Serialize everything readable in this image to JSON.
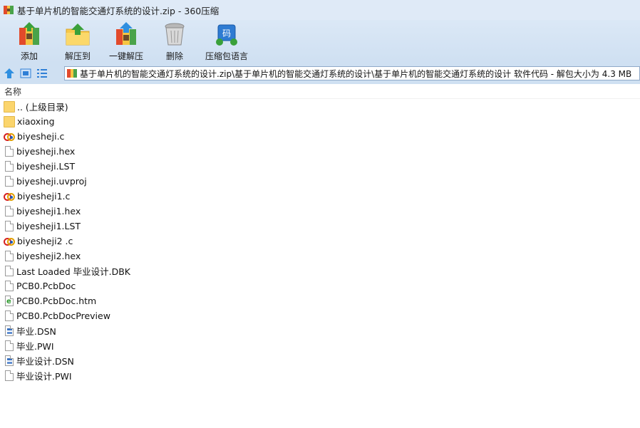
{
  "window": {
    "title": "基于单片机的智能交通灯系统的设计.zip - 360压缩",
    "app_icon": "archive-icon"
  },
  "toolbar": {
    "buttons": [
      {
        "label": "添加",
        "icon": "add-archive-icon"
      },
      {
        "label": "解压到",
        "icon": "extract-to-folder-icon"
      },
      {
        "label": "一键解压",
        "icon": "one-click-extract-icon"
      },
      {
        "label": "删除",
        "icon": "trash-icon"
      },
      {
        "label": "压缩包语言",
        "icon": "archive-language-icon",
        "badge": "码"
      }
    ]
  },
  "address": {
    "path": "基于单片机的智能交通灯系统的设计.zip\\基于单片机的智能交通灯系统的设计\\基于单片机的智能交通灯系统的设计 软件代码 - 解包大小为 4.3 MB"
  },
  "list": {
    "column_name": "名称",
    "items": [
      {
        "name": ".. (上级目录)",
        "icon": "folder-icon"
      },
      {
        "name": "xiaoxing",
        "icon": "folder-icon"
      },
      {
        "name": "biyesheji.c",
        "icon": "c-source-icon"
      },
      {
        "name": "biyesheji.hex",
        "icon": "file-icon"
      },
      {
        "name": "biyesheji.LST",
        "icon": "file-icon"
      },
      {
        "name": "biyesheji.uvproj",
        "icon": "file-icon"
      },
      {
        "name": "biyesheji1.c",
        "icon": "c-source-icon"
      },
      {
        "name": "biyesheji1.hex",
        "icon": "file-icon"
      },
      {
        "name": "biyesheji1.LST",
        "icon": "file-icon"
      },
      {
        "name": "biyesheji2 .c",
        "icon": "c-source-icon"
      },
      {
        "name": "biyesheji2.hex",
        "icon": "file-icon"
      },
      {
        "name": "Last Loaded 毕业设计.DBK",
        "icon": "file-icon"
      },
      {
        "name": "PCB0.PcbDoc",
        "icon": "file-icon"
      },
      {
        "name": "PCB0.PcbDoc.htm",
        "icon": "html-file-icon"
      },
      {
        "name": "PCB0.PcbDocPreview",
        "icon": "file-icon"
      },
      {
        "name": "毕业.DSN",
        "icon": "dsn-file-icon"
      },
      {
        "name": "毕业.PWI",
        "icon": "file-icon"
      },
      {
        "name": "毕业设计.DSN",
        "icon": "dsn-file-icon"
      },
      {
        "name": "毕业设计.PWI",
        "icon": "file-icon"
      }
    ]
  }
}
